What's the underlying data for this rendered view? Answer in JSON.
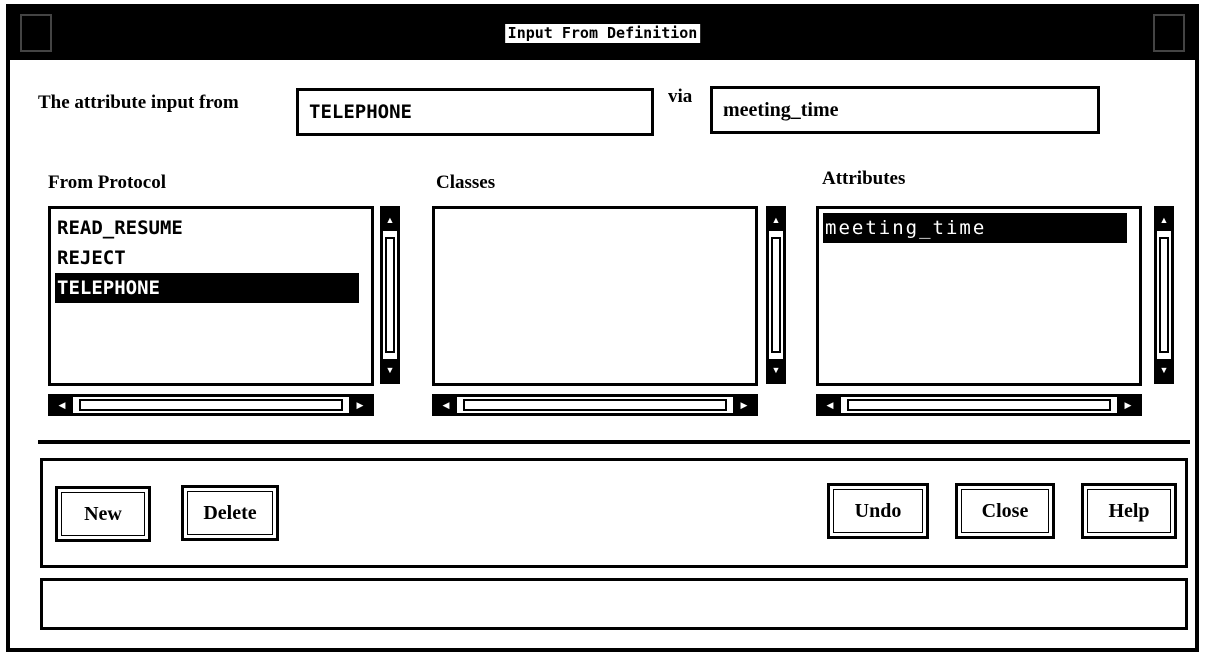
{
  "window": {
    "title": "Input From Definition"
  },
  "header": {
    "attribute_label": "The attribute input from",
    "attribute_value": "TELEPHONE",
    "via_label": "via",
    "via_value": "meeting_time"
  },
  "lists": {
    "protocol": {
      "label": "From Protocol",
      "items": [
        "READ_RESUME",
        "REJECT",
        "TELEPHONE"
      ],
      "selected": "TELEPHONE"
    },
    "classes": {
      "label": "Classes",
      "items": []
    },
    "attributes": {
      "label": "Attributes",
      "items": [
        "meeting_time"
      ],
      "selected": "meeting_time"
    }
  },
  "buttons": {
    "new": "New",
    "delete": "Delete",
    "undo": "Undo",
    "close": "Close",
    "help": "Help"
  },
  "status": {
    "message": ""
  },
  "icons": {
    "window_menu": "window-menu-icon",
    "window_resize": "window-resize-icon",
    "scroll_up": "arrow-up-icon",
    "scroll_down": "arrow-down-icon",
    "scroll_left": "arrow-left-icon",
    "scroll_right": "arrow-right-icon"
  }
}
